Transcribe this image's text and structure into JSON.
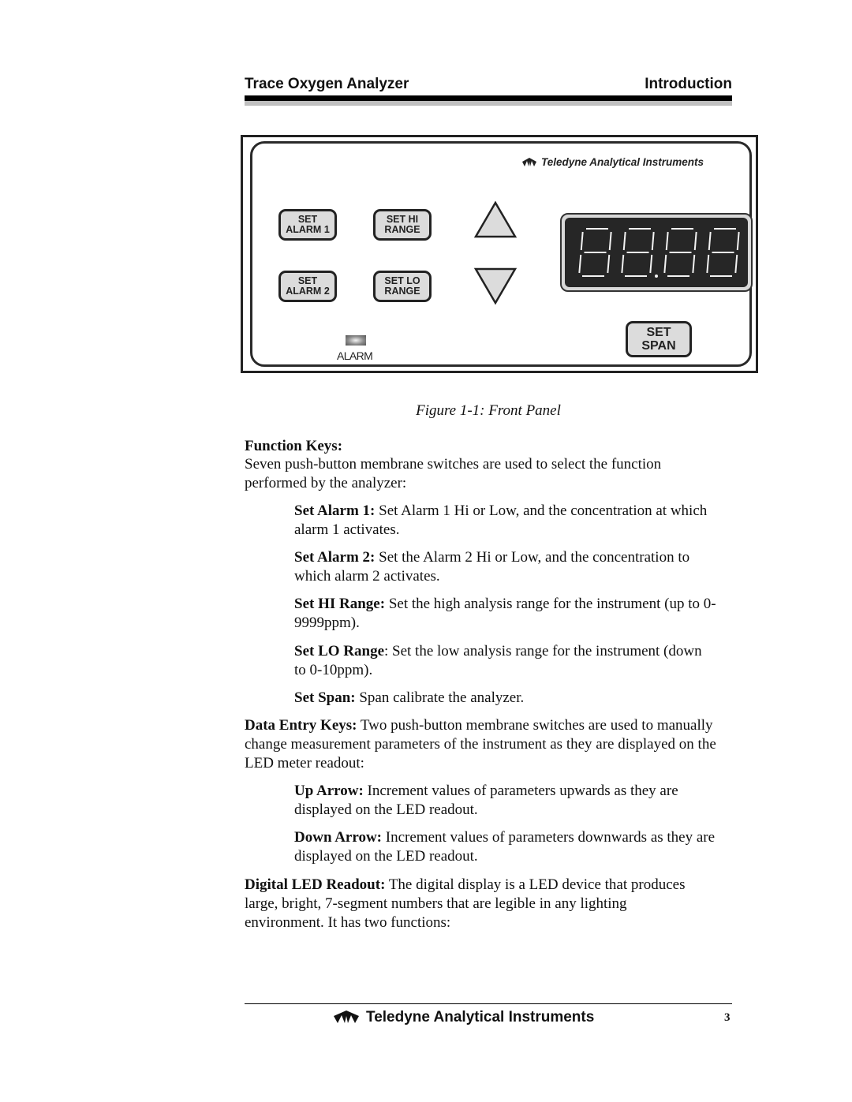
{
  "header": {
    "title": "Trace Oxygen Analyzer",
    "section": "Introduction"
  },
  "figure": {
    "brand_text": "Teledyne Analytical Instruments",
    "brand_icon": "teledyne-logo-icon",
    "keys": {
      "set_alarm_1": [
        "SET",
        "ALARM 1"
      ],
      "set_alarm_2": [
        "SET",
        "ALARM 2"
      ],
      "set_hi_range": [
        "SET HI",
        "RANGE"
      ],
      "set_lo_range": [
        "SET LO",
        "RANGE"
      ],
      "set_span": [
        "SET",
        "SPAN"
      ]
    },
    "arrows": {
      "up_icon": "triangle-up-icon",
      "down_icon": "triangle-down-icon"
    },
    "led_display": {
      "digits": 4,
      "decimal_after_digit": 2,
      "segments_lit": "all-outline"
    },
    "alarm_label": "ALARM",
    "caption": "Figure 1-1:  Front Panel"
  },
  "body": {
    "function_keys_heading": "Function Keys:",
    "function_keys_intro": "Seven push-button membrane switches are used to select the function performed by the analyzer:",
    "function_items": [
      {
        "term": "Set Alarm 1:",
        "text": " Set Alarm 1 Hi or Low, and the concentration at which alarm 1 activates."
      },
      {
        "term": "Set Alarm 2:",
        "text": " Set the Alarm 2 Hi or Low, and the concentration to which alarm 2 activates."
      },
      {
        "term": "Set HI Range:",
        "text": " Set the high analysis range for the instrument (up to 0-9999ppm)."
      },
      {
        "term": "Set LO Range",
        "text": ": Set the low analysis range for the instrument (down to 0-10ppm)."
      },
      {
        "term": "Set Span:",
        "text": " Span calibrate the analyzer."
      }
    ],
    "data_entry": {
      "term": "Data Entry Keys:",
      "text": " Two push-button membrane switches are used to manually change measurement parameters of the instrument as they are displayed on the LED meter readout:"
    },
    "data_entry_items": [
      {
        "term": "Up Arrow:",
        "text": " Increment values of parameters upwards as they are displayed on the LED readout."
      },
      {
        "term": "Down Arrow:",
        "text": " Increment values of parameters downwards as they are displayed on the LED readout."
      }
    ],
    "led_readout": {
      "term": "Digital LED Readout:",
      "text": " The digital display is a LED device that produces large, bright, 7-segment numbers that are legible in any lighting environment. It has two functions:"
    }
  },
  "footer": {
    "brand_text": "Teledyne Analytical Instruments",
    "page_number": "3"
  }
}
